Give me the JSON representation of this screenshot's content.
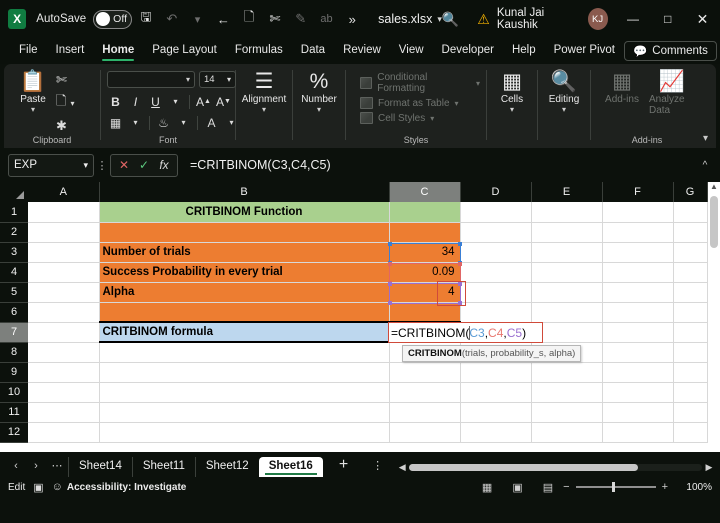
{
  "titlebar": {
    "app_logo": "excel-logo",
    "autosave_label": "AutoSave",
    "autosave_state": "Off",
    "filename": "sales.xlsx",
    "username": "Kunal Jai Kaushik",
    "avatar_initials": "KJ",
    "icons": {
      "save": "save-icon",
      "undo": "undo-icon",
      "redo": "redo-arrow-icon",
      "copy": "copy-icon",
      "cut": "cut-icon",
      "format_painter": "format-painter-icon",
      "spelling": "spelling-icon",
      "more": "more-commands-icon",
      "search": "search-icon",
      "warning": "warning-icon",
      "minimize": "minimize-icon",
      "maximize": "maximize-icon",
      "close": "close-icon"
    }
  },
  "ribbon": {
    "tabs": [
      {
        "label": "File",
        "active": false
      },
      {
        "label": "Insert",
        "active": false
      },
      {
        "label": "Home",
        "active": true
      },
      {
        "label": "Page Layout",
        "active": false
      },
      {
        "label": "Formulas",
        "active": false
      },
      {
        "label": "Data",
        "active": false
      },
      {
        "label": "Review",
        "active": false
      },
      {
        "label": "View",
        "active": false
      },
      {
        "label": "Developer",
        "active": false
      },
      {
        "label": "Help",
        "active": false
      },
      {
        "label": "Power Pivot",
        "active": false
      }
    ],
    "comments_label": "Comments",
    "share_label": "share-icon",
    "groups": {
      "clipboard": {
        "label": "Clipboard",
        "paste_label": "Paste",
        "cut_label": "cut-icon",
        "copy_label": "copy-icon",
        "format_painter_label": "format-painter-icon"
      },
      "font": {
        "label": "Font",
        "font_name_value": "",
        "font_size_value": "14",
        "bold": "B",
        "italic": "I",
        "underline": "U",
        "grow_font": "A",
        "shrink_font": "A",
        "borders": "borders-icon",
        "fill_color": "fill-color-icon",
        "font_color": "A"
      },
      "alignment": {
        "label": "Alignment"
      },
      "number": {
        "label": "Number",
        "glyph": "%"
      },
      "styles": {
        "label": "Styles",
        "items": [
          {
            "label": "Conditional Formatting",
            "disabled": true
          },
          {
            "label": "Format as Table",
            "disabled": true
          },
          {
            "label": "Cell Styles",
            "disabled": true
          }
        ]
      },
      "cells": {
        "label": "Cells"
      },
      "editing": {
        "label": "Editing"
      },
      "addins": {
        "label": "Add-ins",
        "items": [
          {
            "label": "Add-ins",
            "disabled": true
          },
          {
            "label": "Analyze Data",
            "disabled": true
          }
        ]
      }
    }
  },
  "formula_bar": {
    "name_box_value": "EXP",
    "cancel_icon": "cancel-icon",
    "enter_icon": "enter-icon",
    "fx_label": "fx",
    "formula_value": "=CRITBINOM(C3,C4,C5)"
  },
  "grid": {
    "columns": [
      "A",
      "B",
      "C",
      "D",
      "E",
      "F",
      "G"
    ],
    "selected_column": "C",
    "rows": [
      "1",
      "2",
      "3",
      "4",
      "5",
      "6",
      "7",
      "8",
      "9",
      "10",
      "11",
      "12"
    ],
    "selected_row": "7",
    "cells": {
      "b1": "CRITBINOM Function",
      "b3": "Number of trials",
      "c3": "34",
      "b4": "Success Probability in every trial",
      "c4": "0.09",
      "b5": "Alpha",
      "c5": "4",
      "b7": "CRITBINOM formula"
    },
    "editing_cell": {
      "address": "C7",
      "prefix": "=CRITBINOM(",
      "ref1": "C3",
      "sep1": ",",
      "ref2": "C4",
      "sep2": ",",
      "ref3": "C5",
      "suffix": ")"
    },
    "tooltip": {
      "fn_name": "CRITBINOM",
      "args": "(trials, probability_s, alpha)"
    },
    "colors": {
      "header_green": "#A9D08E",
      "body_orange": "#ED7D31",
      "formula_blue": "#BDD7EE",
      "ref1_color": "#5B9BD5",
      "ref2_color": "#E8776F",
      "ref3_color": "#9A6FD0"
    }
  },
  "sheet_tabs": {
    "prev_icon": "chevron-left-icon",
    "next_icon": "chevron-right-icon",
    "more_icon": "more-sheets-icon",
    "tabs": [
      {
        "label": "Sheet14",
        "active": false
      },
      {
        "label": "Sheet11",
        "active": false
      },
      {
        "label": "Sheet12",
        "active": false
      },
      {
        "label": "Sheet16",
        "active": true
      }
    ],
    "add_label": "+",
    "options_icon": "sheet-options-icon"
  },
  "status_bar": {
    "mode": "Edit",
    "macro_icon": "record-macro-icon",
    "accessibility": "Accessibility: Investigate",
    "view_normal": "normal-view-icon",
    "view_page_layout": "page-layout-view-icon",
    "view_page_break": "page-break-view-icon",
    "zoom_out": "zoom-out-icon",
    "zoom_in": "zoom-in-icon",
    "zoom_level": "100%"
  }
}
